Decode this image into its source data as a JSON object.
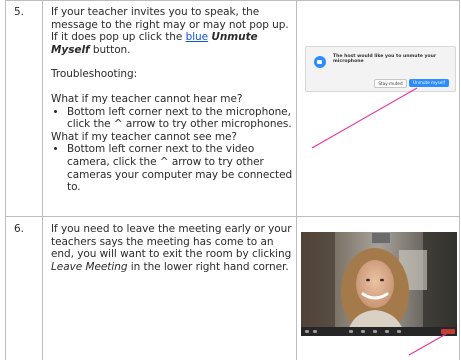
{
  "rows": [
    {
      "number": "5.",
      "intro_before": "If your teacher invites you to speak, the message to the right may or may not pop up. If it does pop up click the ",
      "intro_link": "blue",
      "intro_space": " ",
      "intro_bold": "Unmute Myself",
      "intro_after": " button.",
      "troubleshooting": "Troubleshooting:",
      "q1": "What if my teacher cannot hear me?",
      "q1_bullet": "Bottom left corner next to the microphone, click the ^ arrow to try other microphones.",
      "q2": "What if my teacher cannot see me?",
      "q2_bullet": "Bottom left corner next to the video camera, click the ^ arrow to try other cameras your computer may be connected to."
    },
    {
      "number": "6.",
      "text_before": "If you need to leave the meeting early or your teachers says the meeting has come to an end, you will want to exit the room by clicking ",
      "text_italic": "Leave Meeting",
      "text_after": " in the lower right hand corner."
    }
  ],
  "popup": {
    "message": "The host would like you to unmute your microphone",
    "stay_muted": "Stay muted",
    "unmute_myself": "Unmute myself"
  },
  "colors": {
    "link": "#1155cc",
    "arrow": "#e9329a",
    "zoom_blue": "#2d8cff"
  }
}
